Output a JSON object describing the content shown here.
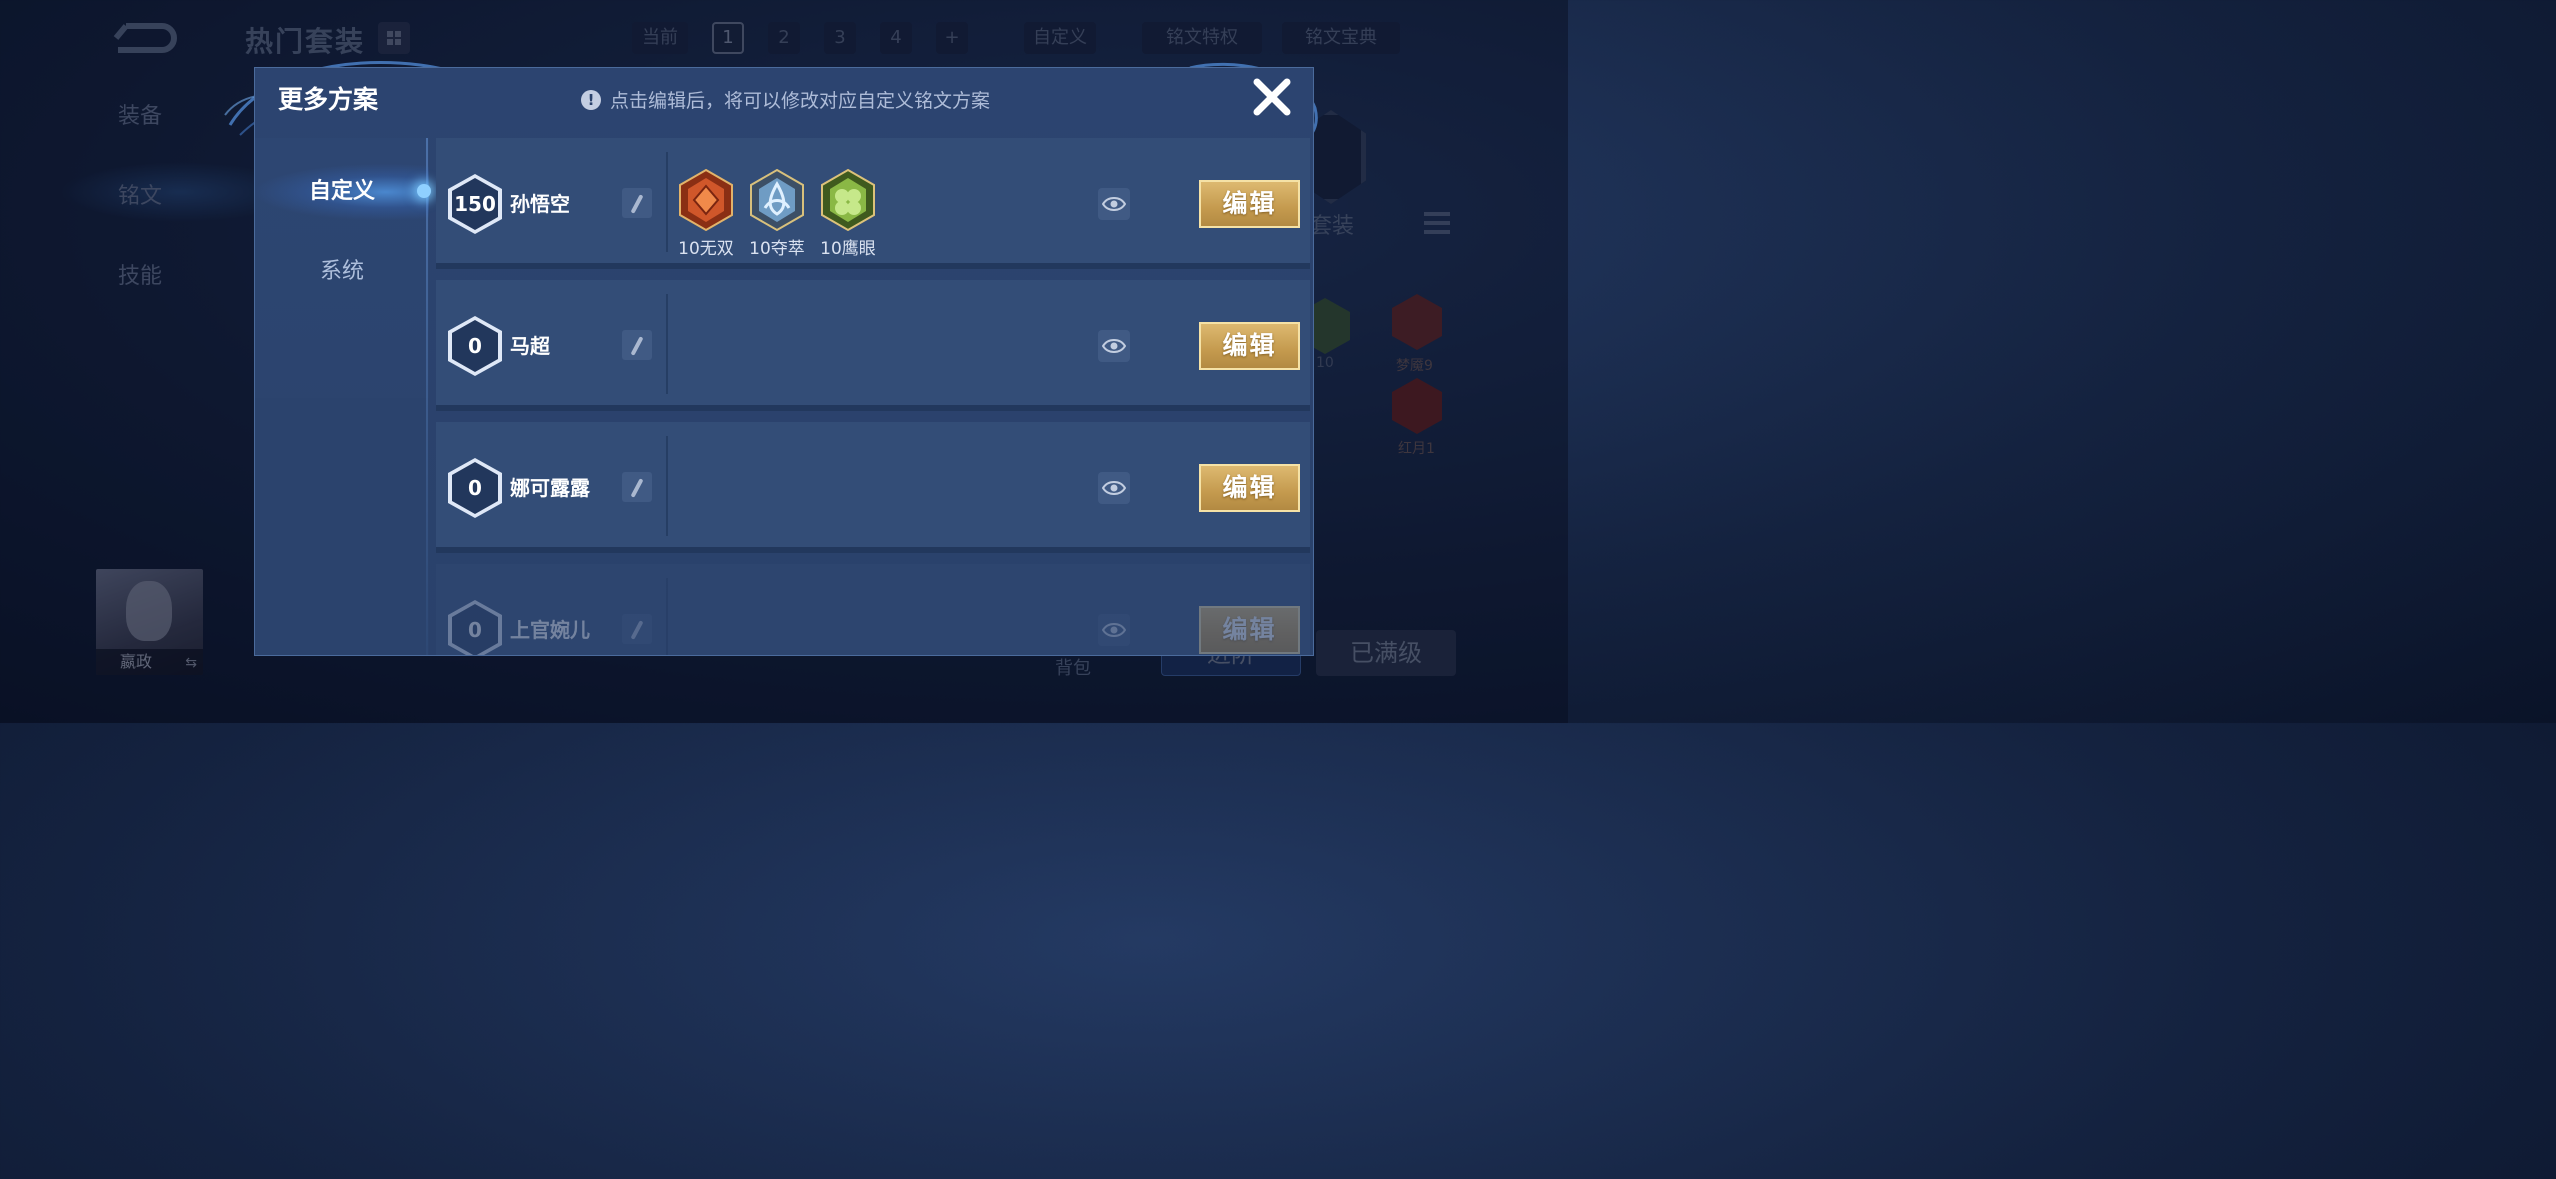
{
  "background": {
    "title": "热门套装",
    "top_nav": [
      "当前",
      "1",
      "2",
      "3",
      "4",
      "+",
      "自定义",
      "铭文特权",
      "铭文宝典"
    ],
    "side_nav": [
      "装备",
      "铭文",
      "技能"
    ],
    "right_label": "套装",
    "rune_labels": [
      "10",
      "梦魇9",
      "红月1"
    ],
    "hero_name": "嬴政",
    "bag_label": "背包",
    "bottom_btn_left": "进阶",
    "bottom_btn_right": "已满级"
  },
  "modal": {
    "title": "更多方案",
    "hint": "点击编辑后，将可以修改对应自定义铭文方案",
    "info_glyph": "!",
    "tabs": [
      "自定义",
      "系统"
    ],
    "edit_label": "编辑",
    "plans": [
      {
        "level": "150",
        "name": "孙悟空",
        "runes": [
          {
            "label": "10无双",
            "color": "#c8532a"
          },
          {
            "label": "10夺萃",
            "color": "#5f8fb8"
          },
          {
            "label": "10鹰眼",
            "color": "#7aa83a"
          }
        ]
      },
      {
        "level": "0",
        "name": "马超",
        "runes": []
      },
      {
        "level": "0",
        "name": "娜可露露",
        "runes": []
      },
      {
        "level": "0",
        "name": "上官婉儿",
        "runes": []
      }
    ]
  },
  "colors": {
    "accent_gold": "#d4b068",
    "modal_bg": "#2c4470",
    "row_bg": "#334d77"
  }
}
